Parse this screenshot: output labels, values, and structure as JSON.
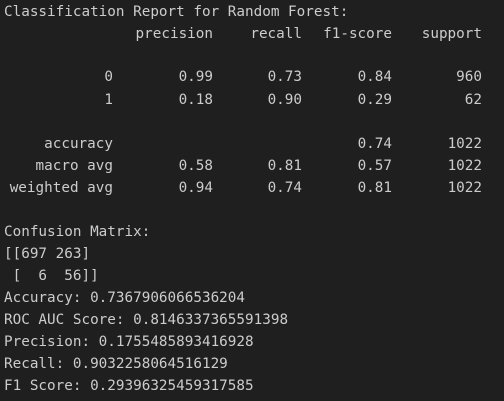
{
  "report": {
    "title": "Classification Report for Random Forest:",
    "headers": {
      "precision": "precision",
      "recall": "recall",
      "f1": "f1-score",
      "support": "support"
    },
    "rows": [
      {
        "label": "0",
        "precision": "0.99",
        "recall": "0.73",
        "f1": "0.84",
        "support": "960"
      },
      {
        "label": "1",
        "precision": "0.18",
        "recall": "0.90",
        "f1": "0.29",
        "support": "62"
      },
      {
        "label": "accuracy",
        "precision": "",
        "recall": "",
        "f1": "0.74",
        "support": "1022"
      },
      {
        "label": "macro avg",
        "precision": "0.58",
        "recall": "0.81",
        "f1": "0.57",
        "support": "1022"
      },
      {
        "label": "weighted avg",
        "precision": "0.94",
        "recall": "0.74",
        "f1": "0.81",
        "support": "1022"
      }
    ]
  },
  "confusion": {
    "title": "Confusion Matrix:",
    "row1": "[[697 263]",
    "row2": " [  6  56]]"
  },
  "metrics": [
    "Accuracy: 0.7367906066536204",
    "ROC AUC Score: 0.8146337365591398",
    "Precision: 0.1755485893416928",
    "Recall: 0.9032258064516129",
    "F1 Score: 0.29396325459317585"
  ]
}
